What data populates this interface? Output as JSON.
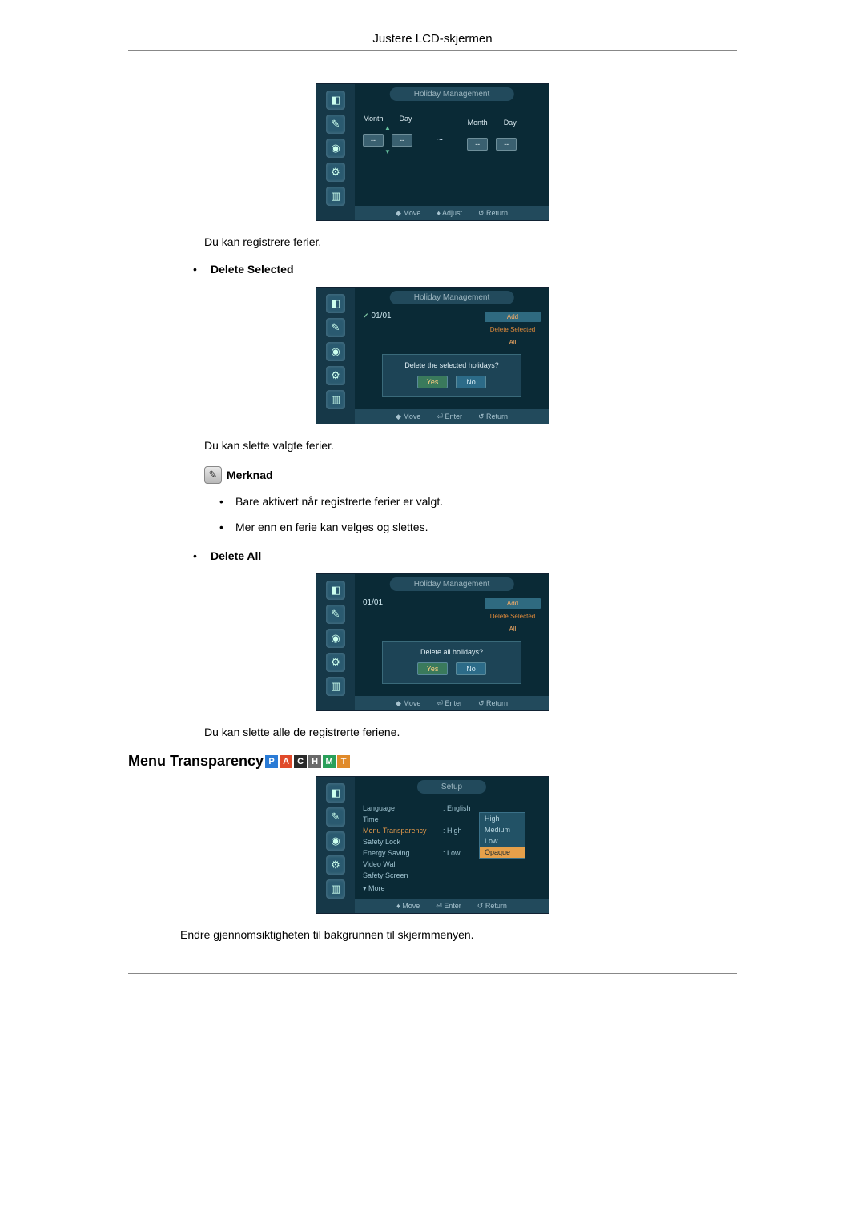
{
  "header": {
    "title": "Justere LCD-skjermen"
  },
  "osd_common": {
    "title_holiday": "Holiday Management",
    "title_setup": "Setup",
    "month": "Month",
    "day": "Day",
    "dash": "--",
    "move": "Move",
    "adjust": "Adjust",
    "enter": "Enter",
    "return": "Return",
    "yes": "Yes",
    "no": "No",
    "more": "▾ More"
  },
  "screenshot1": {
    "text_below": "Du kan registrere ferier."
  },
  "delete_selected": {
    "bullet_label": "Delete Selected",
    "date_item": "01/01",
    "actions": {
      "add": "Add",
      "delete_selected": "Delete Selected",
      "all": "All"
    },
    "dialog": "Delete the selected holidays?",
    "text_below": "Du kan slette valgte ferier."
  },
  "note": {
    "label": "Merknad",
    "items": [
      "Bare aktivert når registrerte ferier er valgt.",
      "Mer enn en ferie kan velges og slettes."
    ]
  },
  "delete_all": {
    "bullet_label": "Delete All",
    "date_item": "01/01",
    "actions": {
      "add": "Add",
      "delete_selected": "Delete Selected",
      "all": "All"
    },
    "dialog": "Delete all holidays?",
    "text_below": "Du kan slette alle de registrerte feriene."
  },
  "menu_transparency": {
    "heading": "Menu Transparency",
    "badges": [
      "P",
      "A",
      "C",
      "H",
      "M",
      "T"
    ],
    "setup_items": [
      {
        "label": "Language",
        "value": ": English",
        "hl": false
      },
      {
        "label": "Time",
        "value": "",
        "hl": false
      },
      {
        "label": "Menu Transparency",
        "value": ": High",
        "hl": true
      },
      {
        "label": "Safety Lock",
        "value": "",
        "hl": false
      },
      {
        "label": "Energy Saving",
        "value": ": Low",
        "hl": false
      },
      {
        "label": "Video Wall",
        "value": "",
        "hl": false
      },
      {
        "label": "Safety Screen",
        "value": "",
        "hl": false
      }
    ],
    "options": [
      "High",
      "Medium",
      "Low",
      "Opaque"
    ],
    "selected_option": "Opaque",
    "text_below": "Endre gjennomsiktigheten til bakgrunnen til skjermmenyen."
  }
}
